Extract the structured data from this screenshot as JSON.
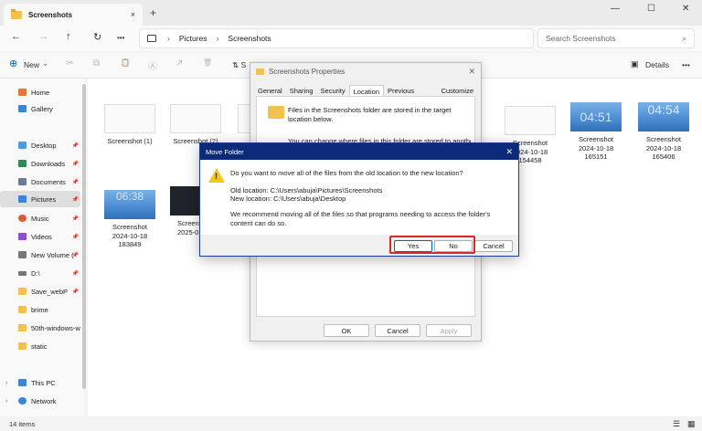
{
  "window": {
    "tab_title": "Screenshots",
    "tab_close": "×",
    "new_tab": "+",
    "minimize": "—",
    "maximize": "☐",
    "close": "✕"
  },
  "nav": {
    "back": "←",
    "forward": "→",
    "up": "↑",
    "refresh": "↻",
    "more": "•••",
    "breadcrumb": [
      "Pictures",
      "Screenshots"
    ],
    "breadcrumb_sep": "›",
    "search_placeholder": "Search Screenshots",
    "search_icon": "⌕"
  },
  "toolbar": {
    "new_label": "New",
    "new_chevron": "⌄",
    "cut": "✂",
    "copy": "⧉",
    "paste": "📋",
    "rename": "Ⓐ",
    "share": "↗",
    "delete": "🗑",
    "sort": "⇅ S",
    "details_label": "Details",
    "more": "•••"
  },
  "sidebar": {
    "items": [
      {
        "label": "Home",
        "icon": "home-icon",
        "color": "#e0793b",
        "pinned": false
      },
      {
        "label": "Gallery",
        "icon": "gallery-icon",
        "color": "#3a86d4",
        "pinned": false
      },
      {
        "label": "Desktop",
        "icon": "desktop-icon",
        "color": "#4a9be0",
        "pinned": true
      },
      {
        "label": "Downloads",
        "icon": "download-icon",
        "color": "#2e8b57",
        "pinned": true
      },
      {
        "label": "Documents",
        "icon": "documents-icon",
        "color": "#6b7c93",
        "pinned": true
      },
      {
        "label": "Pictures",
        "icon": "pictures-icon",
        "color": "#3a86d4",
        "pinned": true
      },
      {
        "label": "Music",
        "icon": "music-icon",
        "color": "#e05a3a",
        "pinned": true
      },
      {
        "label": "Videos",
        "icon": "videos-icon",
        "color": "#8a4fd0",
        "pinned": true
      },
      {
        "label": "New Volume (",
        "icon": "drive-icon",
        "color": "#777777",
        "pinned": true
      },
      {
        "label": "D:\\",
        "icon": "drive-icon",
        "color": "#777777",
        "pinned": true
      },
      {
        "label": "Save_webP",
        "icon": "folder-icon",
        "color": "#f2c14e",
        "pinned": true
      },
      {
        "label": "brime",
        "icon": "folder-icon",
        "color": "#f2c14e",
        "pinned": false
      },
      {
        "label": "50th-windows-w",
        "icon": "folder-icon",
        "color": "#f2c14e",
        "pinned": false
      },
      {
        "label": "static",
        "icon": "folder-icon",
        "color": "#f2c14e",
        "pinned": false
      },
      {
        "label": "This PC",
        "icon": "this-pc-icon",
        "color": "#3a86d4",
        "pinned": false
      },
      {
        "label": "Network",
        "icon": "network-icon",
        "color": "#3a86d4",
        "pinned": false
      }
    ],
    "pin_glyph": "📌",
    "chevron": "›"
  },
  "files": [
    {
      "name": "Screenshot (1)",
      "kind": "doc"
    },
    {
      "name": "Screenshot (2)",
      "kind": "doc"
    },
    {
      "name": "Screenshot 2024-10-18 154458",
      "kind": "doc"
    },
    {
      "name": "Screenshot 2024-10-18 165151",
      "kind": "blue",
      "overlay": "04:51"
    },
    {
      "name": "Screenshot 2024-10-18 165406",
      "kind": "blue",
      "overlay": "04:54"
    },
    {
      "name": "Screenshot 2024-10-18 183849",
      "kind": "blue",
      "overlay": "06:38"
    },
    {
      "name": "Screenshot 2025-0 1020",
      "kind": "dark"
    }
  ],
  "status": {
    "count": "14 items"
  },
  "props_dialog": {
    "title": "Screenshots Properties",
    "close": "✕",
    "tabs": [
      "General",
      "Sharing",
      "Security",
      "Location",
      "Previous Versions",
      "Customize"
    ],
    "selected_tab": "Location",
    "info": "Files in the Screenshots folder are stored in the target location below.",
    "info2": "You can change where files in this folder are stored to another",
    "ok": "OK",
    "cancel": "Cancel",
    "apply": "Apply"
  },
  "move_dialog": {
    "title": "Move Folder",
    "close": "✕",
    "question": "Do you want to move all of the files from the old location to the new location?",
    "old_location": "Old location: C:\\Users\\abuja\\Pictures\\Screenshots",
    "new_location": "New location: C:\\Users\\abuja\\Desktop",
    "recommend": "We recommend moving all of the files so that programs needing to access the folder's content can do so.",
    "yes": "Yes",
    "no": "No",
    "cancel": "Cancel",
    "warning_mark": "!"
  },
  "colors": {
    "accent": "#0067c0",
    "dialog_title": "#0b2b7a",
    "highlight": "#d92a2a",
    "folder": "#f2c14e"
  }
}
